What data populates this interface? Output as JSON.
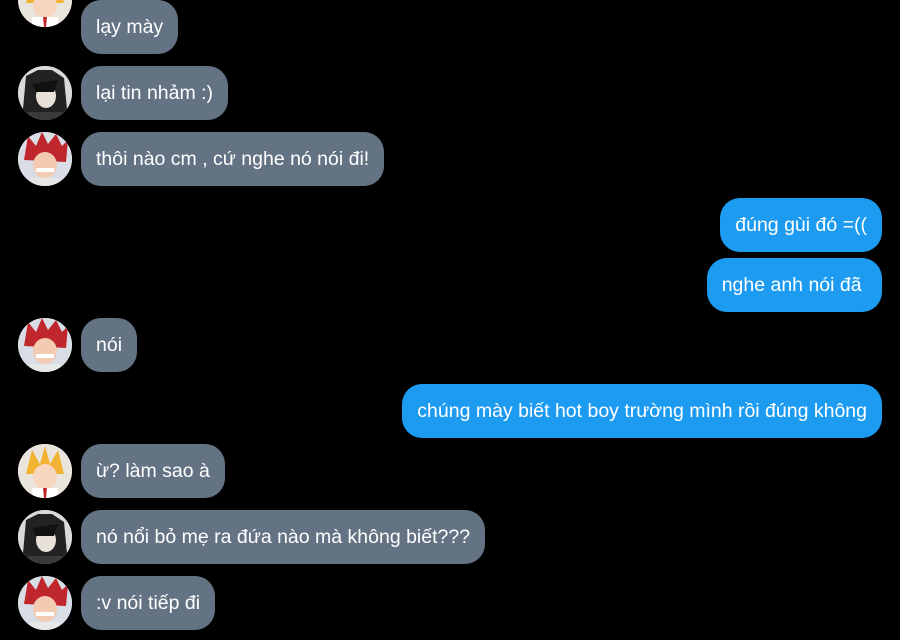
{
  "conversation": {
    "messages": [
      {
        "sender": "blonde",
        "direction": "in",
        "text": "lạy mày"
      },
      {
        "sender": "dark",
        "direction": "in",
        "text": "lại tin nhảm :)"
      },
      {
        "sender": "red",
        "direction": "in",
        "text": "thôi nào cm , cứ nghe nó nói đi!"
      },
      {
        "sender": "me",
        "direction": "out",
        "text": "đúng gùi đó =(("
      },
      {
        "sender": "me",
        "direction": "out",
        "text": "nghe anh nói đã "
      },
      {
        "sender": "red",
        "direction": "in",
        "text": "nói"
      },
      {
        "sender": "me",
        "direction": "out",
        "text": "chúng mày biết hot boy trường mình rồi đúng không"
      },
      {
        "sender": "blonde",
        "direction": "in",
        "text": "ừ? làm sao à"
      },
      {
        "sender": "dark",
        "direction": "in",
        "text": "nó nổi bỏ mẹ ra đứa nào mà không biết???"
      },
      {
        "sender": "red",
        "direction": "in",
        "text": ":v nói tiếp đi"
      }
    ]
  },
  "colors": {
    "background": "#000000",
    "incoming_bubble": "#647384",
    "outgoing_bubble": "#1d9bf0",
    "text": "#ffffff"
  },
  "avatars": {
    "blonde": "blonde-hair-character-avatar",
    "dark": "dark-hair-character-avatar",
    "red": "red-hair-character-avatar"
  }
}
